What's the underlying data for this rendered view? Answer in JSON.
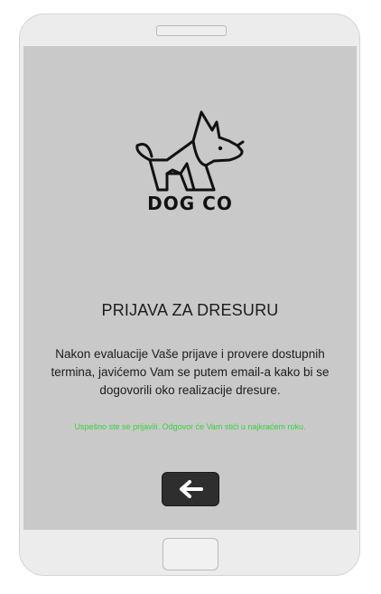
{
  "brand": {
    "name": "DOG CO",
    "logo_icon": "dog-icon"
  },
  "form": {
    "title": "PRIJAVA ZA DRESURU",
    "message": "Nakon evaluacije Vaše prijave i provere dostupnih termina, javićemo Vam se putem email-a kako bi se dogovorili oko realizacije dresure.",
    "success_message": "Uspešno ste se prijavili. Odgovor će Vam stići u najkraćem roku.",
    "success_color": "#3bd13b"
  },
  "actions": {
    "back_icon": "arrow-left-icon"
  },
  "device": {
    "home_button_icon": "home-button"
  }
}
